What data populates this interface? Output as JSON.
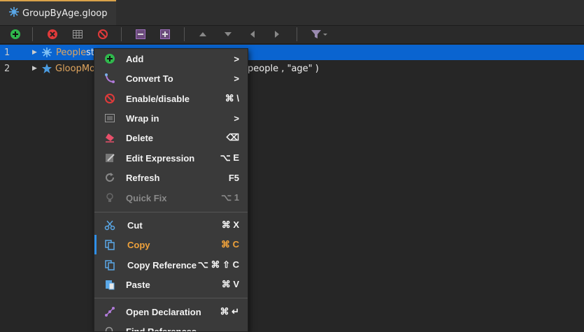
{
  "tab": {
    "title": "GroupByAge.gloop"
  },
  "toolbar": {
    "icons": [
      "add-icon",
      "remove-icon",
      "table-icon",
      "disable-icon",
      "collapse-icon",
      "expand-icon",
      "up-arrow-icon",
      "down-arrow-icon",
      "left-arrow-icon",
      "right-arrow-icon",
      "filter-icon"
    ]
  },
  "editor": {
    "lines": [
      {
        "number": "1",
        "name": "People",
        "rest": " st"
      },
      {
        "number": "2",
        "name": "GloopMo",
        "rest": "people , \"age\" )"
      }
    ]
  },
  "menu": {
    "items": [
      {
        "label": "Add",
        "shortcut": ">",
        "icon": "add-icon"
      },
      {
        "label": "Convert To",
        "shortcut": ">",
        "icon": "convert-icon"
      },
      {
        "label": "Enable/disable",
        "shortcut": "⌘ \\",
        "icon": "disable-icon"
      },
      {
        "label": "Wrap in",
        "shortcut": ">",
        "icon": "wrap-icon"
      },
      {
        "label": "Delete",
        "shortcut": "⌫",
        "icon": "eraser-icon"
      },
      {
        "label": "Edit Expression",
        "shortcut": "⌥ E",
        "icon": "edit-icon"
      },
      {
        "label": "Refresh",
        "shortcut": "F5",
        "icon": "refresh-icon"
      },
      {
        "label": "Quick Fix",
        "shortcut": "⌥ 1",
        "icon": "lightbulb-icon"
      },
      {
        "label": "Cut",
        "shortcut": "⌘ X",
        "icon": "scissors-icon"
      },
      {
        "label": "Copy",
        "shortcut": "⌘ C",
        "icon": "copy-icon"
      },
      {
        "label": "Copy Reference",
        "shortcut": "⌥ ⌘ ⇧ C",
        "icon": "copy-reference-icon"
      },
      {
        "label": "Paste",
        "shortcut": "⌘ V",
        "icon": "paste-icon"
      },
      {
        "label": "Open Declaration",
        "shortcut": "⌘ ↵",
        "icon": "declaration-icon"
      },
      {
        "label": "Find References",
        "shortcut": "",
        "icon": "search-icon"
      }
    ]
  }
}
